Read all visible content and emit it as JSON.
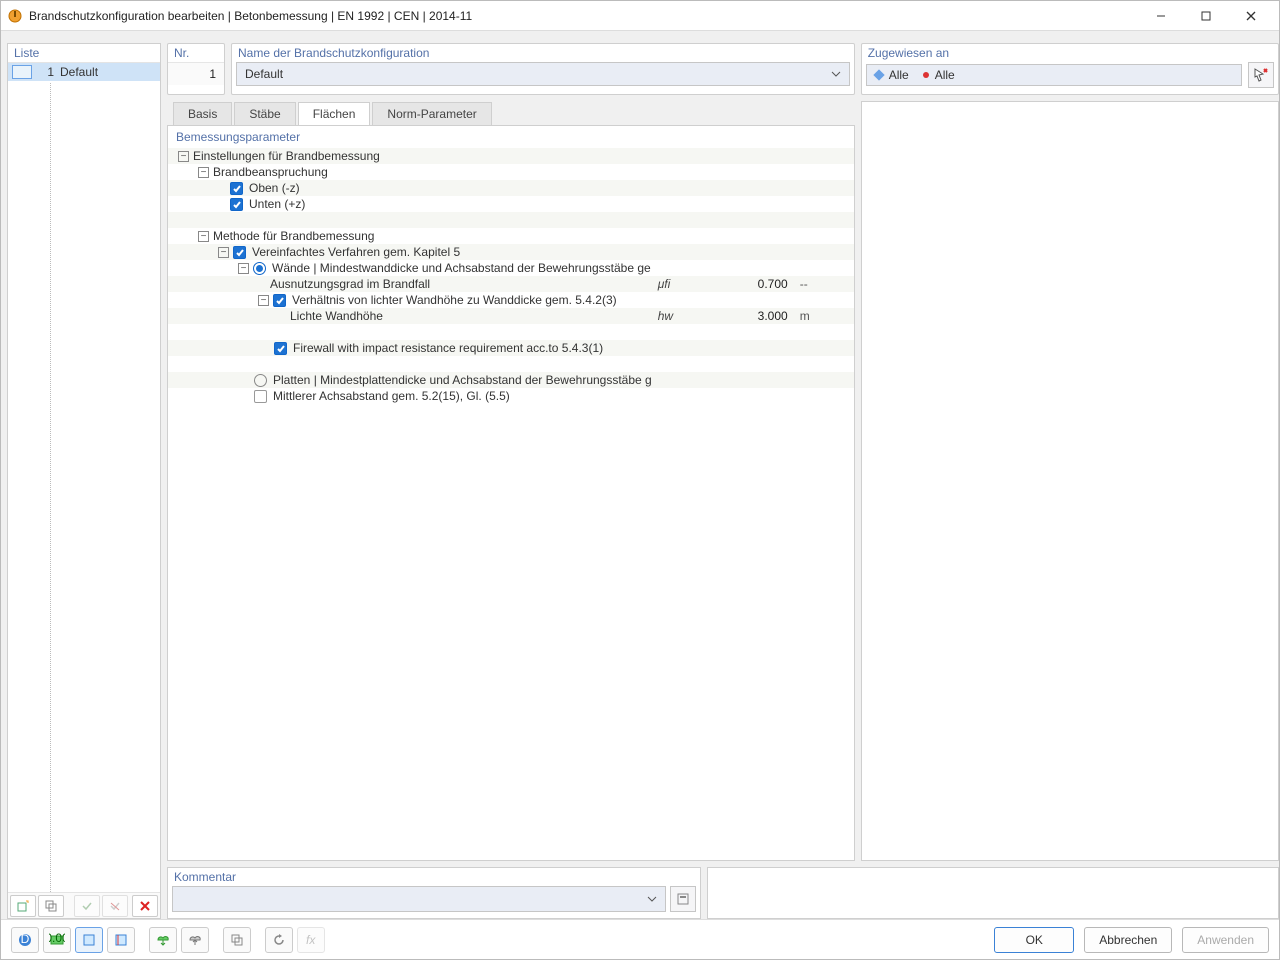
{
  "window_title": "Brandschutzkonfiguration bearbeiten | Betonbemessung | EN 1992 | CEN | 2014-11",
  "list": {
    "header": "Liste",
    "items": [
      {
        "num": "1",
        "label": "Default"
      }
    ]
  },
  "nr": {
    "header": "Nr.",
    "value": "1"
  },
  "name": {
    "header": "Name der Brandschutzkonfiguration",
    "value": "Default"
  },
  "assigned": {
    "header": "Zugewiesen an",
    "value1": "Alle",
    "value2": "Alle"
  },
  "tabs": {
    "t0": "Basis",
    "t1": "Stäbe",
    "t2": "Flächen",
    "t3": "Norm-Parameter",
    "active": 2
  },
  "params": {
    "header": "Bemessungsparameter",
    "g1": "Einstellungen für Brandbemessung",
    "g1_1": "Brandbeanspruchung",
    "g1_1_a": "Oben (-z)",
    "g1_1_b": "Unten (+z)",
    "g1_2": "Methode für Brandbemessung",
    "g1_2_a": "Vereinfachtes Verfahren gem. Kapitel 5",
    "g1_2_a_opt1": "Wände | Mindestwanddicke und Achsabstand der Bewehrungsstäbe ge",
    "g1_2_a_opt1_row1_label": "Ausnutzungsgrad im Brandfall",
    "g1_2_a_opt1_row1_sym": "μfi",
    "g1_2_a_opt1_row1_val": "0.700",
    "g1_2_a_opt1_row1_unit": "--",
    "g1_2_a_opt1_row2_label": "Verhältnis von lichter Wandhöhe zu Wanddicke gem. 5.4.2(3)",
    "g1_2_a_opt1_row3_label": "Lichte Wandhöhe",
    "g1_2_a_opt1_row3_sym": "hw",
    "g1_2_a_opt1_row3_val": "3.000",
    "g1_2_a_opt1_row3_unit": "m",
    "g1_2_a_opt1_row4_label": "Firewall with impact resistance requirement acc.to 5.4.3(1)",
    "g1_2_a_opt2": "Platten | Mindestplattendicke und Achsabstand der Bewehrungsstäbe g",
    "g1_2_a_opt3": "Mittlerer Achsabstand gem. 5.2(15), Gl. (5.5)"
  },
  "comment": {
    "header": "Kommentar",
    "value": ""
  },
  "buttons": {
    "ok": "OK",
    "cancel": "Abbrechen",
    "apply": "Anwenden"
  }
}
